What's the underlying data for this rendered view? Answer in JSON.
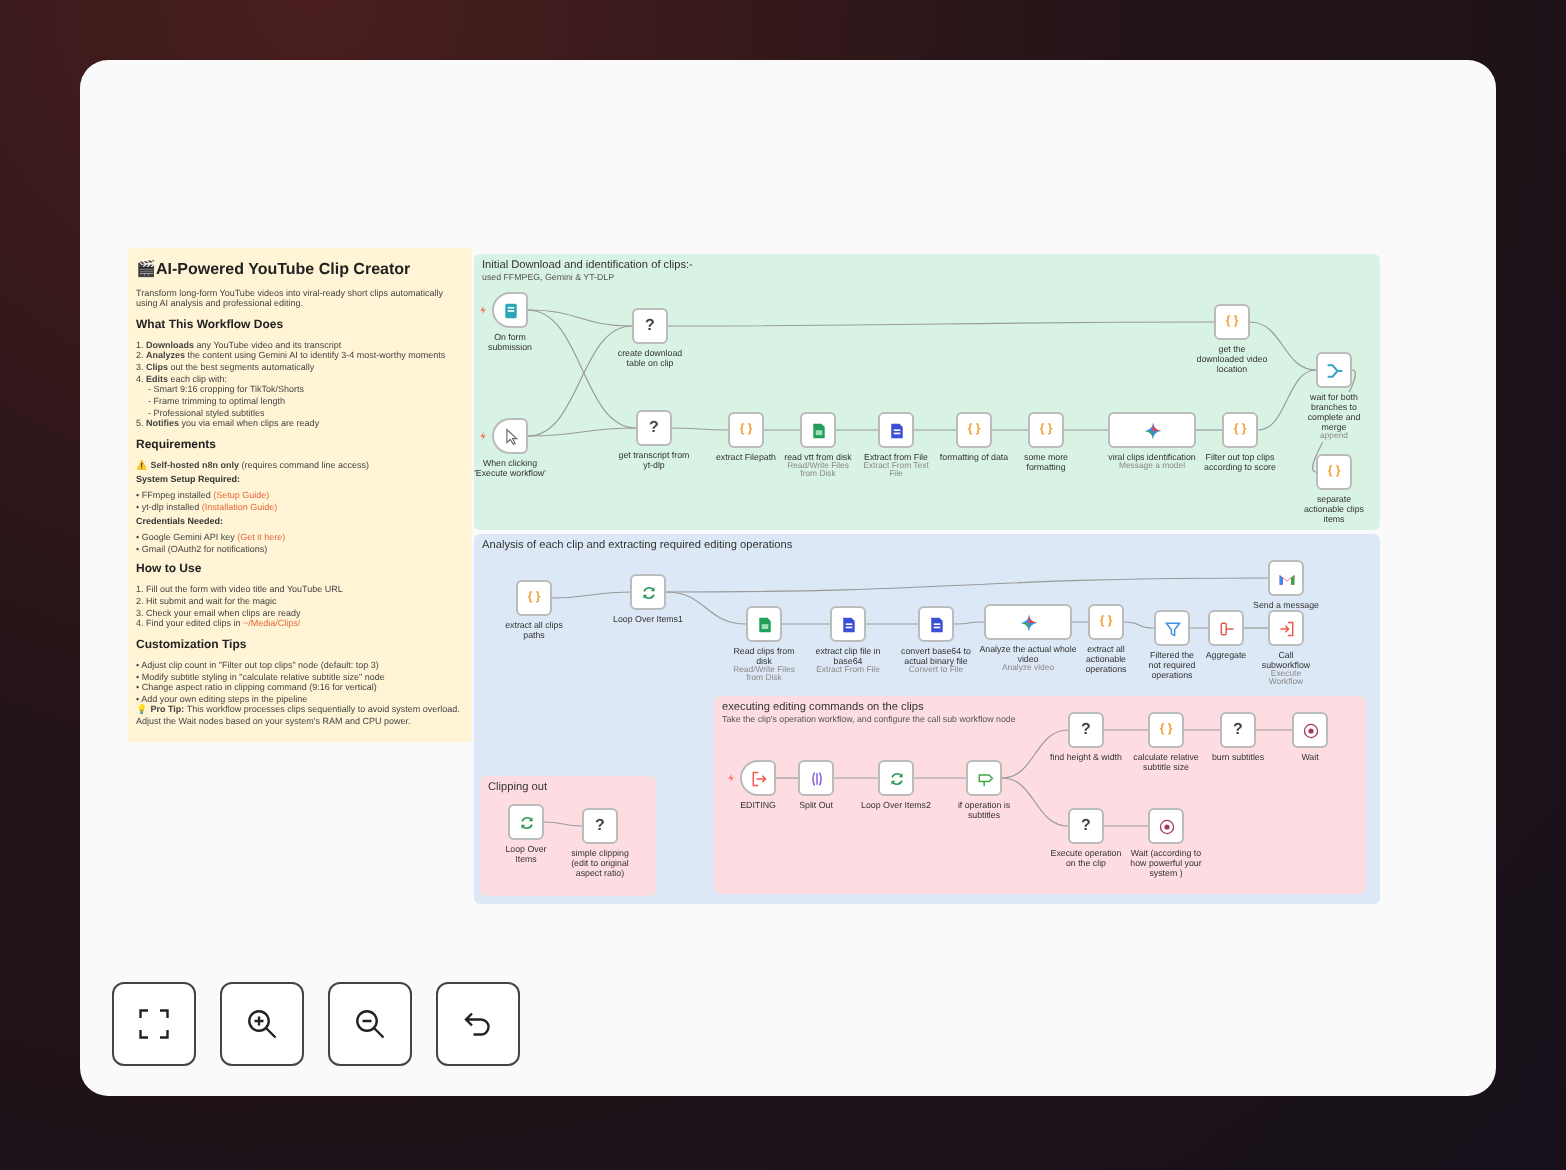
{
  "note": {
    "title": "🎬AI-Powered YouTube Clip Creator",
    "blocks": [
      {
        "kind": "paragraph",
        "text": "Transform long-form YouTube videos into viral-ready short clips automatically using AI analysis and professional editing."
      },
      {
        "kind": "heading",
        "text": "What This Workflow Does"
      },
      {
        "kind": "item",
        "text": "1. **Downloads** any YouTube video and its transcript"
      },
      {
        "kind": "item",
        "text": "2. **Analyzes** the content using Gemini AI to identify 3-4 most-worthy moments"
      },
      {
        "kind": "item",
        "text": "3. **Clips** out the best segments automatically"
      },
      {
        "kind": "item",
        "text": "4. **Edits** each clip with:"
      },
      {
        "kind": "subitem",
        "text": "- Smart 9:16 cropping for TikTok/Shorts"
      },
      {
        "kind": "subitem",
        "text": "- Frame trimming to optimal length"
      },
      {
        "kind": "subitem",
        "text": "- Professional styled subtitles"
      },
      {
        "kind": "item",
        "text": "5. **Notifies** you via email when clips are ready"
      },
      {
        "kind": "heading",
        "text": "Requirements"
      },
      {
        "kind": "item",
        "text": "⚠️ **Self-hosted n8n only** (requires command line access)"
      },
      {
        "kind": "label",
        "text": "System Setup Required:"
      },
      {
        "kind": "item",
        "text": "• FFmpeg installed",
        "link": "(Setup Guide)"
      },
      {
        "kind": "item",
        "text": "• yt-dlp installed",
        "link": "(Installation Guide)"
      },
      {
        "kind": "label",
        "text": "Credentials Needed:"
      },
      {
        "kind": "item",
        "text": "• Google Gemini API key",
        "link": "(Get it here)"
      },
      {
        "kind": "item",
        "text": "• Gmail (OAuth2 for notifications)"
      },
      {
        "kind": "heading",
        "text": "How to Use"
      },
      {
        "kind": "item",
        "text": "1. Fill out the form with video title and YouTube URL"
      },
      {
        "kind": "item",
        "text": "2. Hit submit and wait for the magic"
      },
      {
        "kind": "item",
        "text": "3. Check your email when clips are ready"
      },
      {
        "kind": "item",
        "text": "4. Find your edited clips in",
        "link": "~/Media/Clips/"
      },
      {
        "kind": "heading",
        "text": "Customization Tips"
      },
      {
        "kind": "item",
        "text": "• Adjust clip count in \"Filter out top clips\" node (default: top 3)"
      },
      {
        "kind": "item",
        "text": "• Modify subtitle styling in \"calculate relative subtitle size\" node"
      },
      {
        "kind": "item",
        "text": "• Change aspect ratio in clipping command (9:16 for vertical)"
      },
      {
        "kind": "item",
        "text": "• Add your own editing steps in the pipeline"
      },
      {
        "kind": "paragraph",
        "text": "💡 **Pro Tip:** This workflow processes clips sequentially to avoid system overload. Adjust the Wait nodes based on your system's RAM and CPU power."
      }
    ]
  },
  "groups": [
    {
      "color": "#d8f3e4",
      "title": "Initial Download and identification of clips:-",
      "subtitle": "used FFMPEG, Gemini & YT-DLP",
      "nodes": [
        {
          "kind": "form",
          "label": "On form submission"
        },
        {
          "kind": "unknown",
          "glyph": "?",
          "label": "create download table on clip"
        },
        {
          "kind": "manual",
          "label": "When clicking 'Execute workflow'"
        },
        {
          "kind": "unknown",
          "glyph": "?",
          "label": "get transcript from yt-dlp"
        },
        {
          "kind": "code",
          "glyph": "{ }",
          "label": "extract Filepath"
        },
        {
          "kind": "readfile",
          "label": "read vtt from disk",
          "subtitle": "Read/Write Files from Disk"
        },
        {
          "kind": "extract",
          "label": "Extract from File",
          "subtitle": "Extract From Text File"
        },
        {
          "kind": "code",
          "glyph": "{ }",
          "label": "formatting of data"
        },
        {
          "kind": "code",
          "glyph": "{ }",
          "label": "some more formatting"
        },
        {
          "kind": "gemini",
          "label": "viral clips identification",
          "subtitle": "Message a model"
        },
        {
          "kind": "code",
          "glyph": "{ }",
          "label": "get the downloaded video location"
        },
        {
          "kind": "code",
          "glyph": "{ }",
          "label": "Filter out top clips according to score"
        },
        {
          "kind": "merge",
          "label": "wait for both branches to complete and merge",
          "subtitle": "append"
        },
        {
          "kind": "code",
          "glyph": "{ }",
          "label": "separate actionable clips items"
        }
      ]
    },
    {
      "color": "#dde8f6",
      "title": "Analysis of each clip and extracting required editing operations",
      "nodes": [
        {
          "kind": "code",
          "glyph": "{ }",
          "label": "extract all clips paths"
        },
        {
          "kind": "loop",
          "label": "Loop Over Items1"
        },
        {
          "kind": "readfile",
          "label": "Read clips from disk",
          "subtitle": "Read/Write Files from Disk"
        },
        {
          "kind": "extract",
          "label": "extract clip file in base64",
          "subtitle": "Extract From File"
        },
        {
          "kind": "extract",
          "label": "convert base64 to actual binary file",
          "subtitle": "Convert to File"
        },
        {
          "kind": "gemini",
          "label": "Analyze the actual whole video",
          "subtitle": "Analyze video"
        },
        {
          "kind": "code",
          "glyph": "{ }",
          "label": "extract all actionable operations"
        },
        {
          "kind": "filter",
          "label": "Filtered the not required operations"
        },
        {
          "kind": "aggregate",
          "label": "Aggregate"
        },
        {
          "kind": "gmail",
          "label": "Send a message"
        },
        {
          "kind": "execute",
          "label": "Call subworkflow",
          "subtitle": "Execute Workflow"
        }
      ]
    },
    {
      "color": "#fddde1",
      "title": "Clipping out",
      "nodes": [
        {
          "kind": "loop",
          "label": "Loop Over Items"
        },
        {
          "kind": "unknown",
          "glyph": "?",
          "label": "simple clipping (edit to original aspect ratio)"
        }
      ]
    },
    {
      "color": "#fddde1",
      "title": "executing editing commands on the clips",
      "subtitle": "Take the clip's operation workflow, and configure the call sub workflow node",
      "nodes": [
        {
          "kind": "subtrigger",
          "label": "EDITING"
        },
        {
          "kind": "split",
          "label": "Split Out"
        },
        {
          "kind": "loop",
          "label": "Loop Over Items2"
        },
        {
          "kind": "switch",
          "label": "if operation is subtitles"
        },
        {
          "kind": "unknown",
          "glyph": "?",
          "label": "find height & width"
        },
        {
          "kind": "code",
          "glyph": "{ }",
          "label": "calculate relative subtitle size"
        },
        {
          "kind": "unknown",
          "glyph": "?",
          "label": "burn subtitles"
        },
        {
          "kind": "wait",
          "label": "Wait"
        },
        {
          "kind": "unknown",
          "glyph": "?",
          "label": "Execute operation on the clip"
        },
        {
          "kind": "wait",
          "label": "Wait (according to how powerful your system )"
        }
      ]
    }
  ],
  "controls": [
    {
      "kind": "fit"
    },
    {
      "kind": "zoom-in"
    },
    {
      "kind": "zoom-out"
    },
    {
      "kind": "undo"
    }
  ]
}
